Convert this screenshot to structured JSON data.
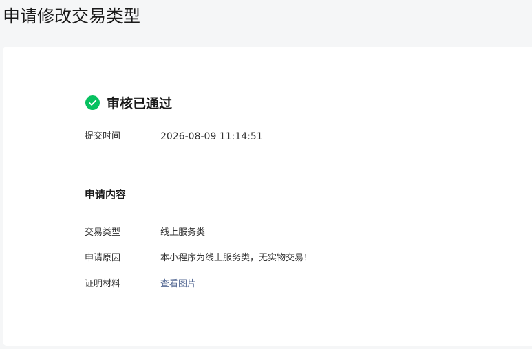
{
  "page": {
    "title": "申请修改交易类型"
  },
  "status": {
    "icon": "check-circle-icon",
    "color": "#07c160",
    "text": "审核已通过"
  },
  "submit_info": {
    "label": "提交时间",
    "value": "2026-08-09 11:14:51"
  },
  "content": {
    "section_title": "申请内容",
    "fields": [
      {
        "label": "交易类型",
        "value": "线上服务类"
      },
      {
        "label": "申请原因",
        "value": "本小程序为线上服务类，无实物交易！"
      },
      {
        "label": "证明材料",
        "value": "查看图片"
      }
    ],
    "link_color": "#576b95"
  }
}
